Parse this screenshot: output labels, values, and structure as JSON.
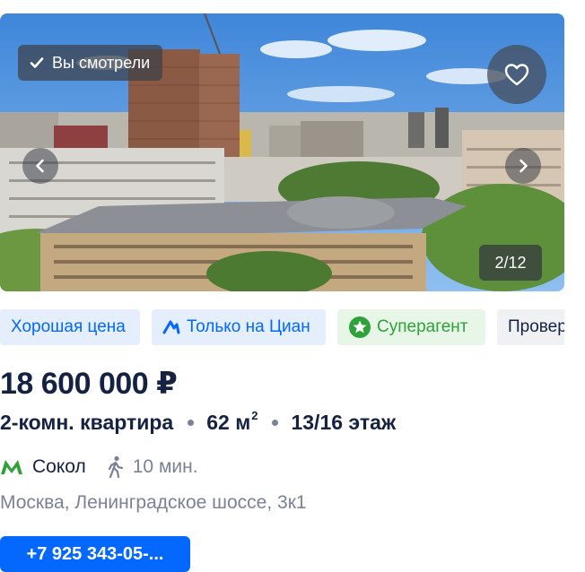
{
  "photo": {
    "viewed_label": "Вы смотрели",
    "counter": "2/12",
    "current_index": 2,
    "total": 12
  },
  "tags": [
    {
      "label": "Хорошая цена",
      "style": "blue",
      "icon": ""
    },
    {
      "label": "Только на Циан",
      "style": "blue",
      "icon": "cian-logo-icon"
    },
    {
      "label": "Суперагент",
      "style": "green",
      "icon": "star-badge-icon"
    },
    {
      "label": "Проверено",
      "style": "grey",
      "icon": ""
    }
  ],
  "listing": {
    "price": "18 600 000 ₽",
    "rooms": "2-комн. квартира",
    "area_value": "62 м",
    "area_sup": "2",
    "floor": "13/16 этаж",
    "metro": "Сокол",
    "walk_time": "10 мин.",
    "address": "Москва, Ленинградское шоссе, 3к1",
    "phone": "+7 925 343-05-..."
  },
  "colors": {
    "accent": "#0468ff",
    "metro": "#2fa13a",
    "text": "#152242",
    "secondary": "#7a8294"
  }
}
